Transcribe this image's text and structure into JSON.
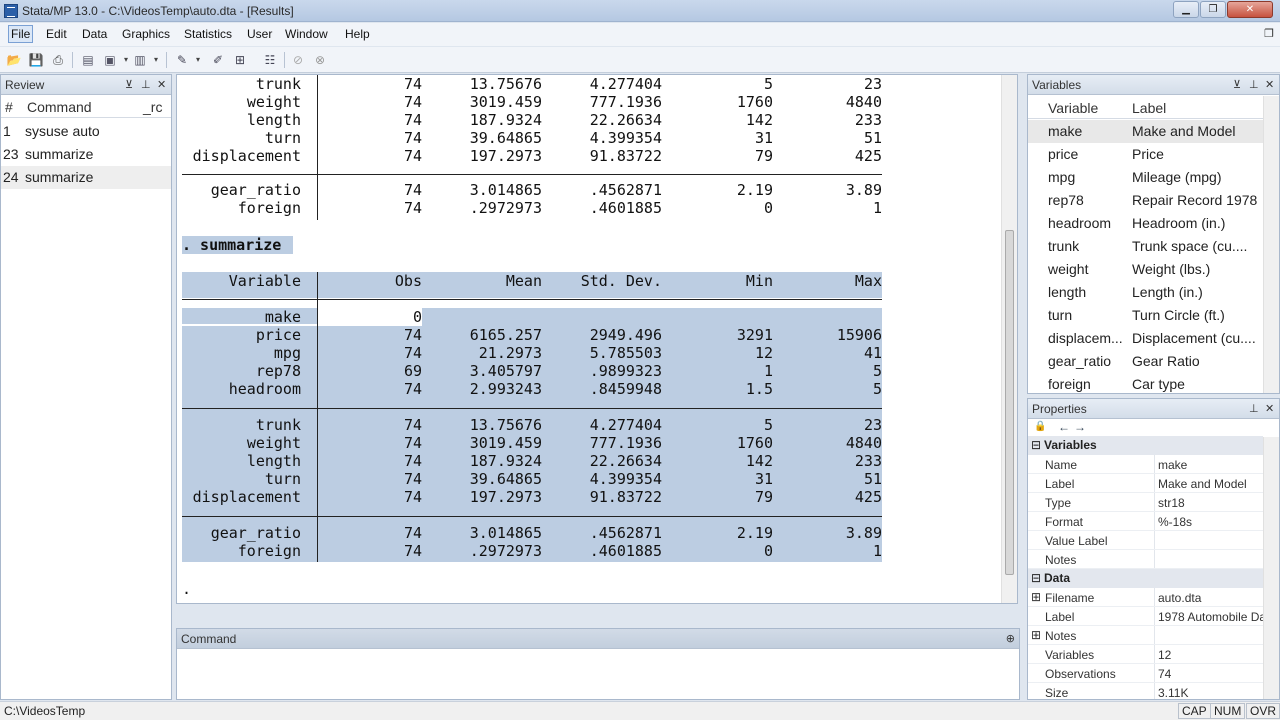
{
  "window": {
    "title": "Stata/MP 13.0 - C:\\VideosTemp\\auto.dta - [Results]",
    "minimize": "▁",
    "maximize": "❐",
    "close": "✕"
  },
  "menubar": {
    "items": [
      "File",
      "Edit",
      "Data",
      "Graphics",
      "Statistics",
      "User",
      "Window",
      "Help"
    ],
    "restore_glyph": "❐"
  },
  "review": {
    "title": "Review",
    "columns": [
      "#",
      "Command",
      "_rc"
    ],
    "rows": [
      {
        "num": "1",
        "command": "sysuse auto"
      },
      {
        "num": "23",
        "command": "summarize"
      },
      {
        "num": "24",
        "command": "summarize"
      }
    ]
  },
  "results": {
    "top_block": [
      {
        "variable": "trunk",
        "obs": "74",
        "mean": "13.75676",
        "sd": "4.277404",
        "min": "5",
        "max": "23"
      },
      {
        "variable": "weight",
        "obs": "74",
        "mean": "3019.459",
        "sd": "777.1936",
        "min": "1760",
        "max": "4840"
      },
      {
        "variable": "length",
        "obs": "74",
        "mean": "187.9324",
        "sd": "22.26634",
        "min": "142",
        "max": "233"
      },
      {
        "variable": "turn",
        "obs": "74",
        "mean": "39.64865",
        "sd": "4.399354",
        "min": "31",
        "max": "51"
      },
      {
        "variable": "displacement",
        "obs": "74",
        "mean": "197.2973",
        "sd": "91.83722",
        "min": "79",
        "max": "425"
      }
    ],
    "top_block2": [
      {
        "variable": "gear_ratio",
        "obs": "74",
        "mean": "3.014865",
        "sd": ".4562871",
        "min": "2.19",
        "max": "3.89"
      },
      {
        "variable": "foreign",
        "obs": "74",
        "mean": ".2972973",
        "sd": ".4601885",
        "min": "0",
        "max": "1"
      }
    ],
    "command_echo": ". summarize",
    "headers": {
      "variable": "Variable",
      "obs": "Obs",
      "mean": "Mean",
      "sd": "Std. Dev.",
      "min": "Min",
      "max": "Max"
    },
    "group1": [
      {
        "variable": "make",
        "obs": "0",
        "mean": "",
        "sd": "",
        "min": "",
        "max": ""
      },
      {
        "variable": "price",
        "obs": "74",
        "mean": "6165.257",
        "sd": "2949.496",
        "min": "3291",
        "max": "15906"
      },
      {
        "variable": "mpg",
        "obs": "74",
        "mean": "21.2973",
        "sd": "5.785503",
        "min": "12",
        "max": "41"
      },
      {
        "variable": "rep78",
        "obs": "69",
        "mean": "3.405797",
        "sd": ".9899323",
        "min": "1",
        "max": "5"
      },
      {
        "variable": "headroom",
        "obs": "74",
        "mean": "2.993243",
        "sd": ".8459948",
        "min": "1.5",
        "max": "5"
      }
    ],
    "group2": [
      {
        "variable": "trunk",
        "obs": "74",
        "mean": "13.75676",
        "sd": "4.277404",
        "min": "5",
        "max": "23"
      },
      {
        "variable": "weight",
        "obs": "74",
        "mean": "3019.459",
        "sd": "777.1936",
        "min": "1760",
        "max": "4840"
      },
      {
        "variable": "length",
        "obs": "74",
        "mean": "187.9324",
        "sd": "22.26634",
        "min": "142",
        "max": "233"
      },
      {
        "variable": "turn",
        "obs": "74",
        "mean": "39.64865",
        "sd": "4.399354",
        "min": "31",
        "max": "51"
      },
      {
        "variable": "displacement",
        "obs": "74",
        "mean": "197.2973",
        "sd": "91.83722",
        "min": "79",
        "max": "425"
      }
    ],
    "group3": [
      {
        "variable": "gear_ratio",
        "obs": "74",
        "mean": "3.014865",
        "sd": ".4562871",
        "min": "2.19",
        "max": "3.89"
      },
      {
        "variable": "foreign",
        "obs": "74",
        "mean": ".2972973",
        "sd": ".4601885",
        "min": "0",
        "max": "1"
      }
    ],
    "prompt": "."
  },
  "command": {
    "title": "Command",
    "value": "",
    "pin": "⊕"
  },
  "variables": {
    "title": "Variables",
    "columns": [
      "Variable",
      "Label"
    ],
    "rows": [
      {
        "name": "make",
        "label": "Make and Model"
      },
      {
        "name": "price",
        "label": "Price"
      },
      {
        "name": "mpg",
        "label": "Mileage (mpg)"
      },
      {
        "name": "rep78",
        "label": "Repair Record 1978"
      },
      {
        "name": "headroom",
        "label": "Headroom (in.)"
      },
      {
        "name": "trunk",
        "label": "Trunk space (cu...."
      },
      {
        "name": "weight",
        "label": "Weight (lbs.)"
      },
      {
        "name": "length",
        "label": "Length (in.)"
      },
      {
        "name": "turn",
        "label": "Turn Circle (ft.)"
      },
      {
        "name": "displacem...",
        "label": "Displacement (cu...."
      },
      {
        "name": "gear_ratio",
        "label": "Gear Ratio"
      },
      {
        "name": "foreign",
        "label": "Car type"
      }
    ]
  },
  "properties": {
    "title": "Properties",
    "sections": [
      {
        "title": "Variables",
        "rows": [
          {
            "key": "Name",
            "value": "make"
          },
          {
            "key": "Label",
            "value": "Make and Model"
          },
          {
            "key": "Type",
            "value": "str18"
          },
          {
            "key": "Format",
            "value": "%-18s"
          },
          {
            "key": "Value Label",
            "value": ""
          },
          {
            "key": "Notes",
            "value": ""
          }
        ]
      },
      {
        "title": "Data",
        "rows": [
          {
            "key": "Filename",
            "value": "auto.dta"
          },
          {
            "key": "Label",
            "value": "1978 Automobile Da"
          },
          {
            "key": "Notes",
            "value": ""
          },
          {
            "key": "Variables",
            "value": "12"
          },
          {
            "key": "Observations",
            "value": "74"
          },
          {
            "key": "Size",
            "value": "3.11K"
          }
        ]
      }
    ]
  },
  "statusbar": {
    "path": "C:\\VideosTemp",
    "indicators": [
      "CAP",
      "NUM",
      "OVR"
    ]
  }
}
